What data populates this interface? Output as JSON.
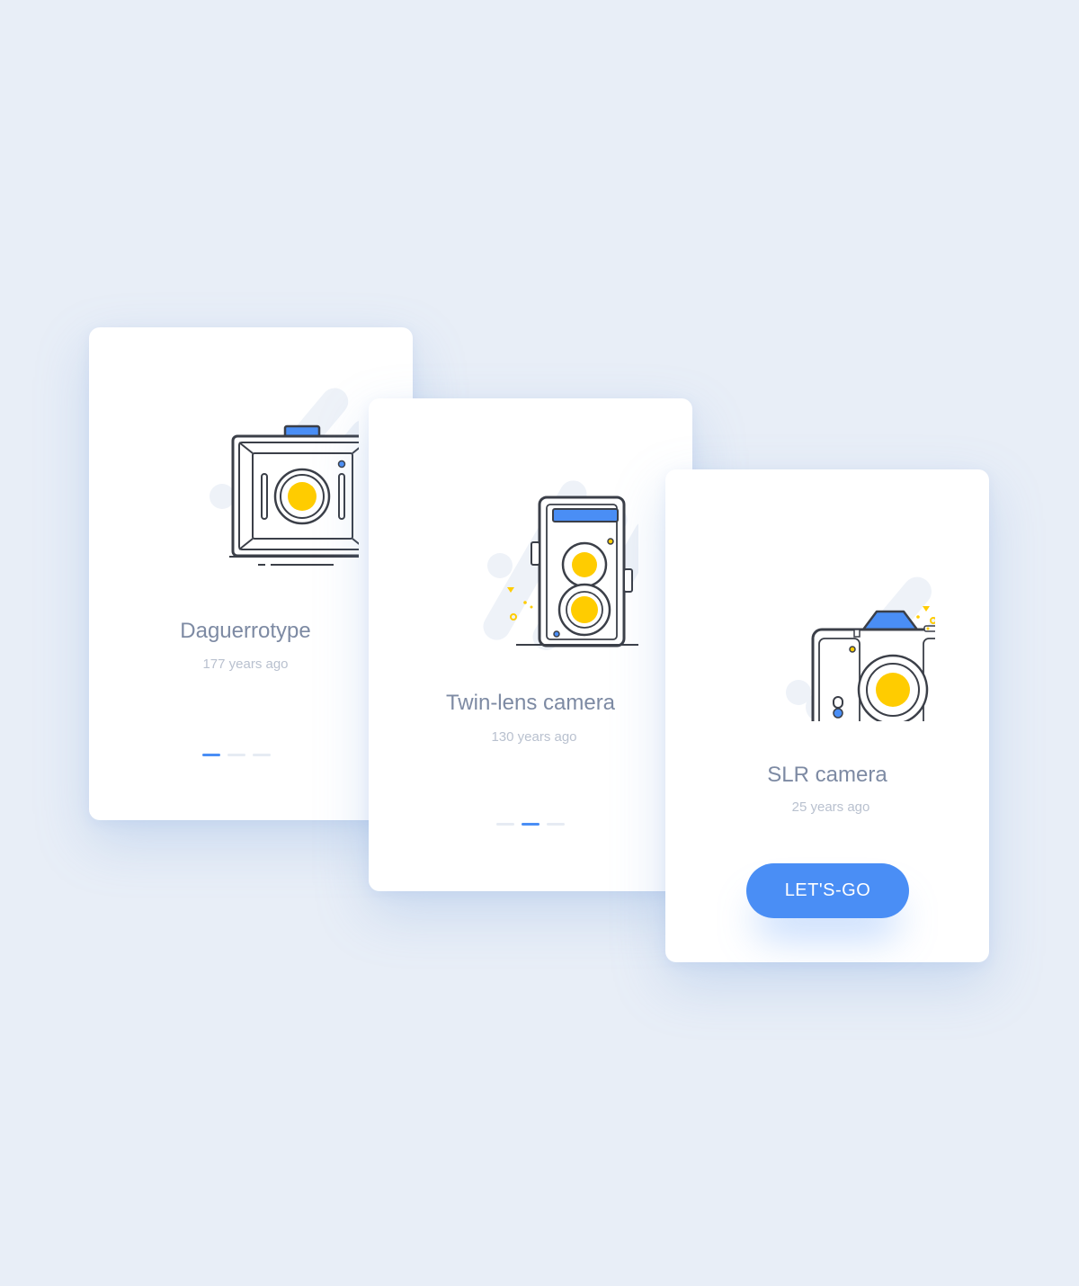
{
  "colors": {
    "background": "#e8eef7",
    "card": "#ffffff",
    "accent_blue": "#4a8ef5",
    "lens_yellow": "#ffcc00",
    "title_text": "#7d8aa3",
    "subtitle_text": "#b9c1cf",
    "outline": "#3b3f48"
  },
  "cards": [
    {
      "title": "Daguerrotype",
      "subtitle": "177 years ago",
      "icon": "daguerreotype-camera-icon",
      "pager": {
        "count": 3,
        "active_index": 0
      }
    },
    {
      "title": "Twin-lens camera",
      "subtitle": "130 years ago",
      "icon": "twin-lens-camera-icon",
      "pager": {
        "count": 3,
        "active_index": 1
      }
    },
    {
      "title": "SLR camera",
      "subtitle": "25 years ago",
      "icon": "slr-camera-icon",
      "button_label": "LET'S-GO"
    }
  ]
}
